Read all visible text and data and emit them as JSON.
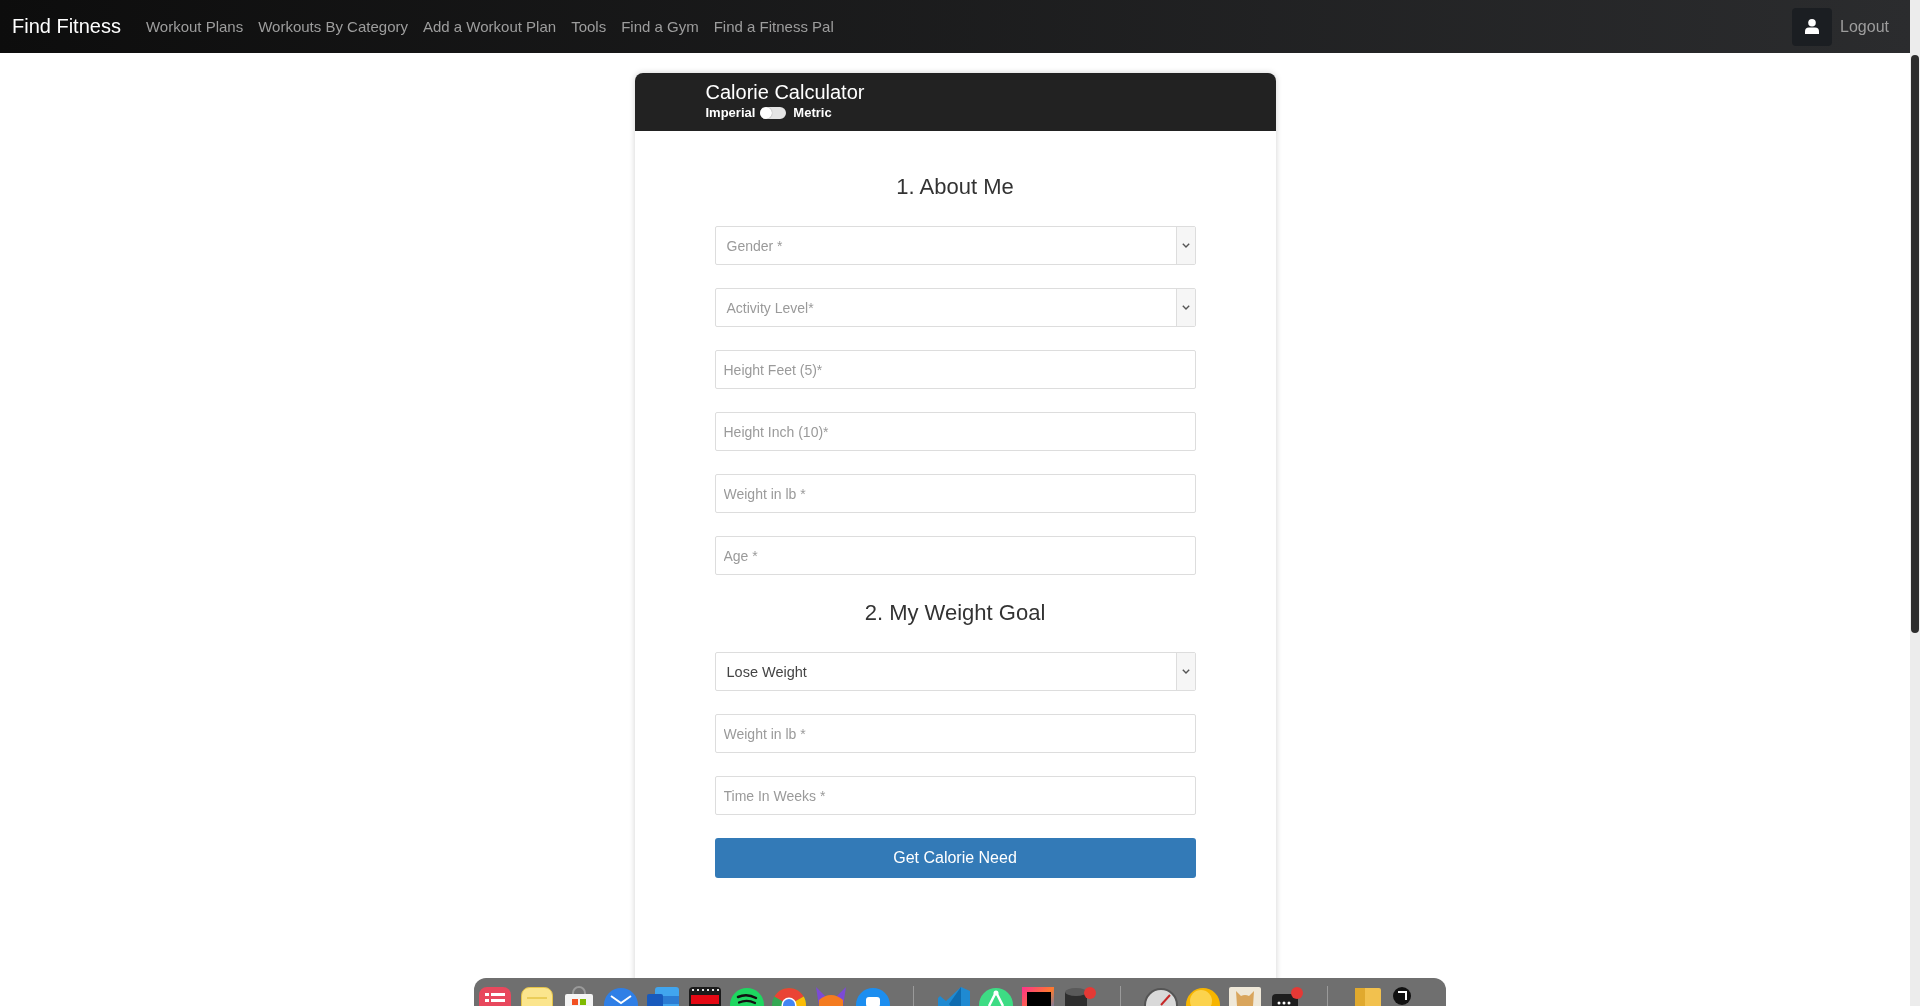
{
  "navbar": {
    "brand": "Find Fitness",
    "links": [
      "Workout Plans",
      "Workouts By Category",
      "Add a Workout Plan",
      "Tools",
      "Find a Gym",
      "Find a Fitness Pal"
    ],
    "logout": "Logout"
  },
  "card": {
    "title": "Calorie Calculator",
    "unit_toggle": {
      "left_label": "Imperial",
      "on": false,
      "right_label": "Metric"
    }
  },
  "sections": [
    {
      "heading": "1. About Me",
      "fields": [
        {
          "kind": "select",
          "placeholder": "Gender *"
        },
        {
          "kind": "select",
          "placeholder": "Activity Level*"
        },
        {
          "kind": "input",
          "placeholder": "Height Feet (5)*"
        },
        {
          "kind": "input",
          "placeholder": "Height Inch (10)*"
        },
        {
          "kind": "input",
          "placeholder": "Weight in lb *"
        },
        {
          "kind": "input",
          "placeholder": "Age *"
        }
      ]
    },
    {
      "heading": "2. My Weight Goal",
      "fields": [
        {
          "kind": "select",
          "value": "Lose Weight"
        },
        {
          "kind": "input",
          "placeholder": "Weight in lb *"
        },
        {
          "kind": "input",
          "placeholder": "Time In Weeks *"
        }
      ]
    }
  ],
  "submit_button": "Get Calorie Need"
}
